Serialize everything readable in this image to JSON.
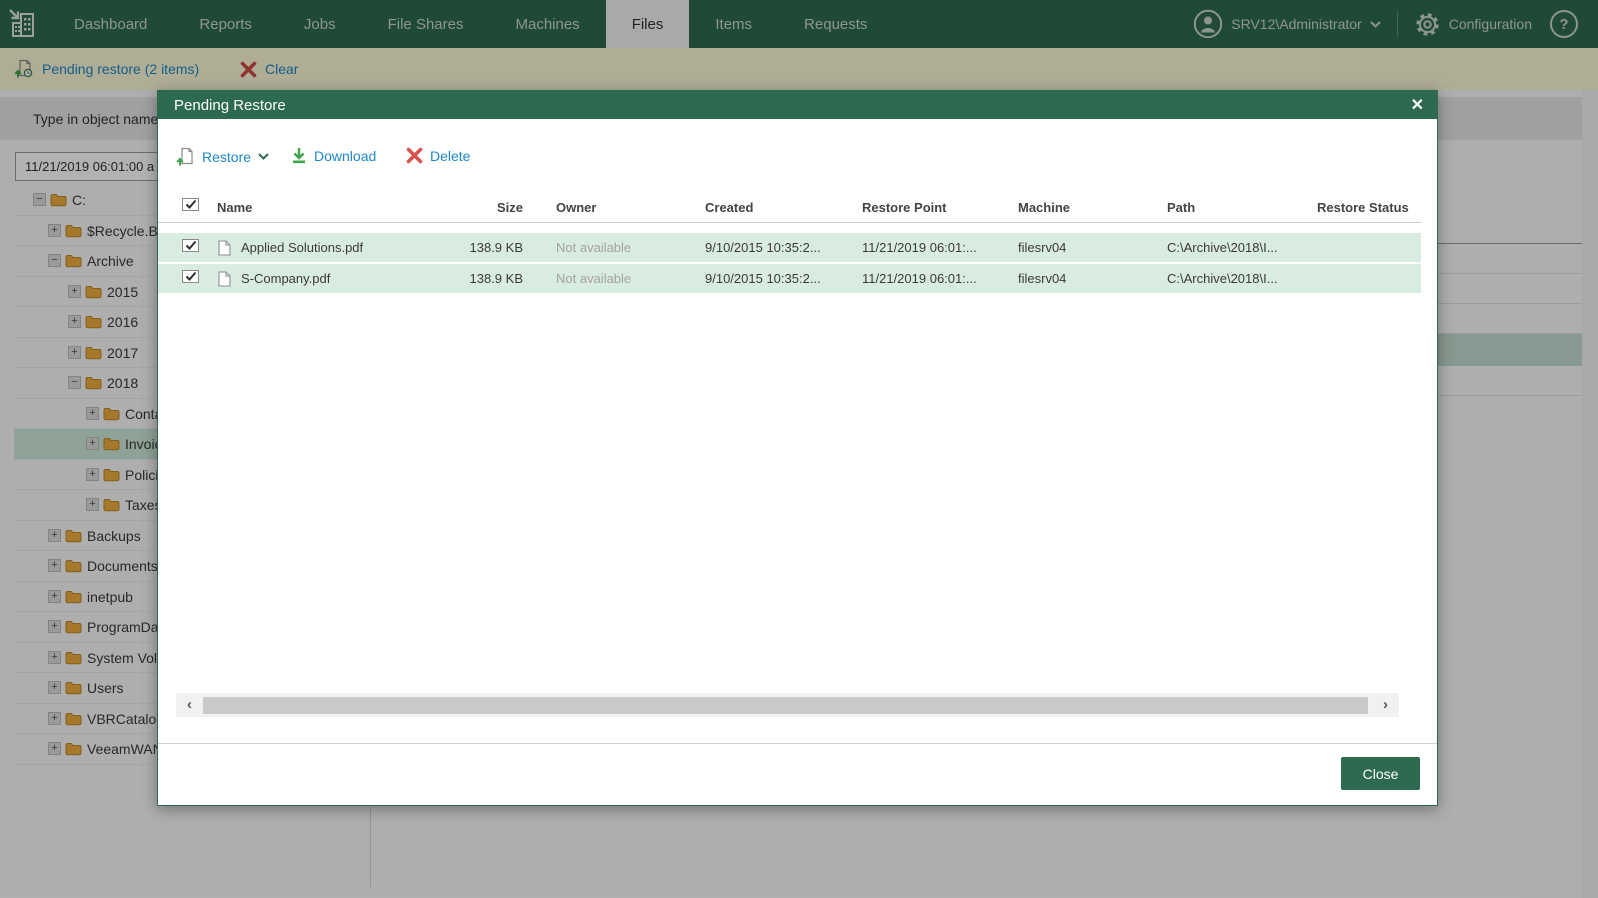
{
  "nav": {
    "items": [
      {
        "label": "Dashboard",
        "active": false
      },
      {
        "label": "Reports",
        "active": false
      },
      {
        "label": "Jobs",
        "active": false
      },
      {
        "label": "File Shares",
        "active": false
      },
      {
        "label": "Machines",
        "active": false
      },
      {
        "label": "Files",
        "active": true
      },
      {
        "label": "Items",
        "active": false
      },
      {
        "label": "Requests",
        "active": false
      }
    ],
    "user": "SRV12\\Administrator",
    "configuration_label": "Configuration",
    "help_label": "?"
  },
  "banner": {
    "pending_label": "Pending restore (2 items)",
    "clear_label": "Clear"
  },
  "background": {
    "object_name_label": "Type in object name:",
    "date_value": "11/21/2019 06:01:00 a",
    "tree": [
      {
        "label": "C:",
        "level": 0,
        "expanded": true,
        "selected": false
      },
      {
        "label": "$Recycle.Bin",
        "level": 1,
        "expanded": false,
        "selected": false
      },
      {
        "label": "Archive",
        "level": 1,
        "expanded": true,
        "selected": false
      },
      {
        "label": "2015",
        "level": 2,
        "expanded": false,
        "selected": false
      },
      {
        "label": "2016",
        "level": 2,
        "expanded": false,
        "selected": false
      },
      {
        "label": "2017",
        "level": 2,
        "expanded": false,
        "selected": false
      },
      {
        "label": "2018",
        "level": 2,
        "expanded": true,
        "selected": false
      },
      {
        "label": "Conta",
        "level": 3,
        "expanded": false,
        "selected": false
      },
      {
        "label": "Invoic",
        "level": 3,
        "expanded": false,
        "selected": true
      },
      {
        "label": "Policie",
        "level": 3,
        "expanded": false,
        "selected": false
      },
      {
        "label": "Taxes",
        "level": 3,
        "expanded": false,
        "selected": false
      },
      {
        "label": "Backups",
        "level": 1,
        "expanded": false,
        "selected": false
      },
      {
        "label": "Documents a",
        "level": 1,
        "expanded": false,
        "selected": false
      },
      {
        "label": "inetpub",
        "level": 1,
        "expanded": false,
        "selected": false
      },
      {
        "label": "ProgramData",
        "level": 1,
        "expanded": false,
        "selected": false
      },
      {
        "label": "System Volu",
        "level": 1,
        "expanded": false,
        "selected": false
      },
      {
        "label": "Users",
        "level": 1,
        "expanded": false,
        "selected": false
      },
      {
        "label": "VBRCatalog",
        "level": 1,
        "expanded": false,
        "selected": false
      },
      {
        "label": "VeeamWAN",
        "level": 1,
        "expanded": false,
        "selected": false
      }
    ]
  },
  "modal": {
    "title": "Pending Restore",
    "close_icon": "✕",
    "toolbar": {
      "restore_label": "Restore",
      "download_label": "Download",
      "delete_label": "Delete"
    },
    "table": {
      "headers": [
        "Name",
        "Size",
        "Owner",
        "Created",
        "Restore Point",
        "Machine",
        "Path",
        "Restore Status"
      ],
      "rows": [
        {
          "checked": true,
          "name": "Applied Solutions.pdf",
          "size": "138.9 KB",
          "owner": "Not available",
          "created": "9/10/2015 10:35:2...",
          "restore_point": "11/21/2019 06:01:...",
          "machine": "filesrv04",
          "path": "C:\\Archive\\2018\\I...",
          "status": ""
        },
        {
          "checked": true,
          "name": "S-Company.pdf",
          "size": "138.9 KB",
          "owner": "Not available",
          "created": "9/10/2015 10:35:2...",
          "restore_point": "11/21/2019 06:01:...",
          "machine": "filesrv04",
          "path": "C:\\Archive\\2018\\I...",
          "status": ""
        }
      ]
    },
    "scrollbar": {
      "left_arrow": "‹",
      "right_arrow": "›"
    },
    "close_button": "Close"
  },
  "colors": {
    "brand_green": "#2d6a4f",
    "link_blue": "#1e87c5",
    "banner_yellow": "#fdf8d8",
    "row_highlight": "#d9ece2",
    "tree_selection": "#cde8da",
    "folder_gold": "#eead3e",
    "delete_red": "#d9534f",
    "action_green": "#3fa54a"
  }
}
